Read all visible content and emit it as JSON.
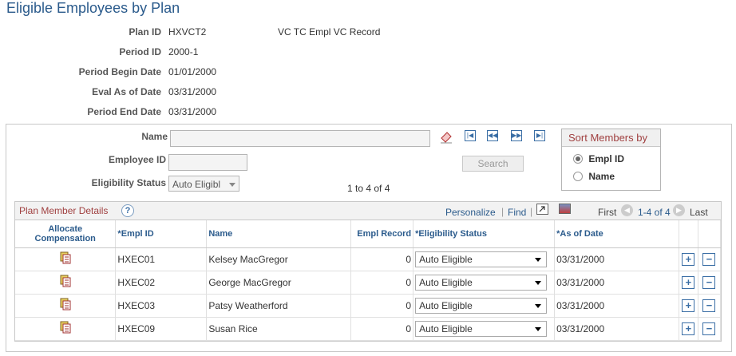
{
  "page": {
    "title": "Eligible Employees by Plan"
  },
  "header": {
    "plan_id_label": "Plan ID",
    "plan_id": "HXVCT2",
    "plan_desc": "VC TC Empl VC Record",
    "period_id_label": "Period ID",
    "period_id": "2000-1",
    "period_begin_label": "Period Begin Date",
    "period_begin": "01/01/2000",
    "eval_label": "Eval As of Date",
    "eval": "03/31/2000",
    "period_end_label": "Period End Date",
    "period_end": "03/31/2000"
  },
  "search": {
    "name_label": "Name",
    "name_value": "",
    "empl_id_label": "Employee ID",
    "empl_id_value": "",
    "elig_label": "Eligibility Status",
    "elig_value": "Auto Eligibl",
    "search_button": "Search",
    "count_text": "1 to 4 of 4"
  },
  "sort": {
    "title": "Sort Members by",
    "options": [
      "Empl ID",
      "Name"
    ],
    "selected": "Empl ID"
  },
  "grid": {
    "title": "Plan Member Details",
    "personalize": "Personalize",
    "find": "Find",
    "first": "First",
    "range": "1-4 of 4",
    "last": "Last",
    "columns": {
      "allocate": "Allocate Compensation",
      "empl_id": "*Empl ID",
      "name": "Name",
      "empl_record": "Empl Record",
      "elig_status": "*Eligibility Status",
      "as_of_date": "*As of Date"
    },
    "rows": [
      {
        "empl_id": "HXEC01",
        "name": "Kelsey MacGregor",
        "empl_record": "0",
        "status": "Auto Eligible",
        "date": "03/31/2000"
      },
      {
        "empl_id": "HXEC02",
        "name": "George MacGregor",
        "empl_record": "0",
        "status": "Auto Eligible",
        "date": "03/31/2000"
      },
      {
        "empl_id": "HXEC03",
        "name": "Patsy Weatherford",
        "empl_record": "0",
        "status": "Auto Eligible",
        "date": "03/31/2000"
      },
      {
        "empl_id": "HXEC09",
        "name": "Susan Rice",
        "empl_record": "0",
        "status": "Auto Eligible",
        "date": "03/31/2000"
      }
    ]
  },
  "colors": {
    "accent": "#2b5b8c",
    "sort_title": "#a04040"
  }
}
